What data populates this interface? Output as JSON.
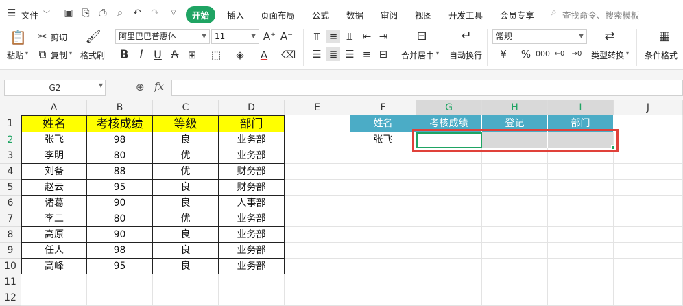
{
  "menu": {
    "file_label": "文件",
    "tabs": [
      "开始",
      "插入",
      "页面布局",
      "公式",
      "数据",
      "审阅",
      "视图",
      "开发工具",
      "会员专享"
    ],
    "active_tab": "开始",
    "search_placeholder": "查找命令、搜索模板"
  },
  "ribbon": {
    "paste": "粘贴",
    "cut": "剪切",
    "copy": "复制",
    "format_painter": "格式刷",
    "font_name": "阿里巴巴普惠体",
    "font_size": "11",
    "merge_center": "合并居中",
    "auto_wrap": "自动换行",
    "number_format": "常规",
    "type_convert": "类型转换",
    "conditional_format": "条件格式"
  },
  "formula_bar": {
    "name_box": "G2",
    "fx": "fx",
    "formula": ""
  },
  "columns": [
    "A",
    "B",
    "C",
    "D",
    "E",
    "F",
    "G",
    "H",
    "I",
    "J"
  ],
  "rows": [
    "1",
    "2",
    "3",
    "4",
    "5",
    "6",
    "7",
    "8",
    "9",
    "10",
    "11",
    "12"
  ],
  "table1": {
    "headers": [
      "姓名",
      "考核成绩",
      "等级",
      "部门"
    ],
    "rows": [
      [
        "张飞",
        "98",
        "良",
        "业务部"
      ],
      [
        "李明",
        "80",
        "优",
        "业务部"
      ],
      [
        "刘备",
        "88",
        "优",
        "财务部"
      ],
      [
        "赵云",
        "95",
        "良",
        "财务部"
      ],
      [
        "诸葛",
        "90",
        "良",
        "人事部"
      ],
      [
        "李二",
        "80",
        "优",
        "业务部"
      ],
      [
        "高原",
        "90",
        "良",
        "业务部"
      ],
      [
        "任人",
        "98",
        "良",
        "业务部"
      ],
      [
        "高峰",
        "95",
        "良",
        "业务部"
      ]
    ]
  },
  "table2": {
    "headers": [
      "姓名",
      "考核成绩",
      "登记",
      "部门"
    ],
    "row": [
      "张飞",
      "",
      "",
      ""
    ]
  },
  "colors": {
    "accent": "#1fa463",
    "yellow_header": "#ffff00",
    "blue_header": "#4bacc6",
    "highlight_box": "#e0413a"
  }
}
